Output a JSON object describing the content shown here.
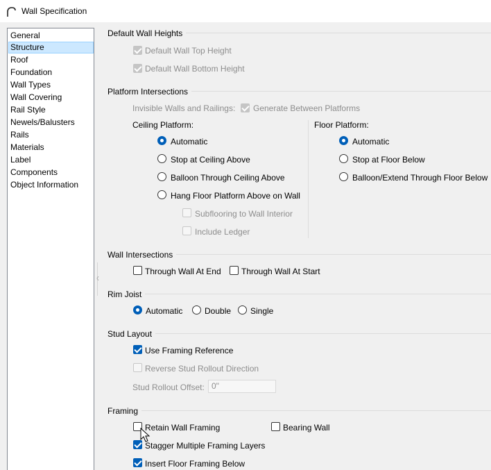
{
  "window": {
    "title": "Wall Specification",
    "icon": "arch-icon"
  },
  "sidebar": {
    "items": [
      {
        "label": "General"
      },
      {
        "label": "Structure",
        "selected": true
      },
      {
        "label": "Roof"
      },
      {
        "label": "Foundation"
      },
      {
        "label": "Wall Types"
      },
      {
        "label": "Wall Covering"
      },
      {
        "label": "Rail Style"
      },
      {
        "label": "Newels/Balusters"
      },
      {
        "label": "Rails"
      },
      {
        "label": "Materials"
      },
      {
        "label": "Label"
      },
      {
        "label": "Components"
      },
      {
        "label": "Object Information"
      }
    ]
  },
  "default_wall_heights": {
    "title": "Default Wall Heights",
    "top_label": "Default Wall Top Height",
    "bottom_label": "Default Wall Bottom Height"
  },
  "platform_intersections": {
    "title": "Platform Intersections",
    "invisible_label": "Invisible Walls and Railings:",
    "generate_label": "Generate Between Platforms",
    "ceiling": {
      "title": "Ceiling Platform:",
      "options": [
        "Automatic",
        "Stop at Ceiling Above",
        "Balloon Through Ceiling Above",
        "Hang Floor Platform Above on Wall"
      ],
      "selected": "Automatic",
      "subflooring_label": "Subflooring to Wall Interior",
      "ledger_label": "Include Ledger"
    },
    "floor": {
      "title": "Floor Platform:",
      "options": [
        "Automatic",
        "Stop at Floor Below",
        "Balloon/Extend Through Floor Below"
      ],
      "selected": "Automatic"
    }
  },
  "wall_intersections": {
    "title": "Wall Intersections",
    "end_label": "Through Wall At End",
    "start_label": "Through Wall At Start"
  },
  "rim_joist": {
    "title": "Rim Joist",
    "options": [
      "Automatic",
      "Double",
      "Single"
    ],
    "selected": "Automatic"
  },
  "stud_layout": {
    "title": "Stud Layout",
    "use_framing_label": "Use Framing Reference",
    "reverse_label": "Reverse Stud Rollout Direction",
    "offset_label": "Stud Rollout Offset:",
    "offset_value": "0\""
  },
  "framing": {
    "title": "Framing",
    "retain_label": "Retain Wall Framing",
    "bearing_label": "Bearing Wall",
    "stagger_label": "Stagger Multiple Framing Layers",
    "insert_label": "Insert Floor Framing Below"
  },
  "colors": {
    "accent": "#005fb8",
    "selection_bg": "#cce8ff",
    "disabled_text": "#8d8d8d"
  }
}
